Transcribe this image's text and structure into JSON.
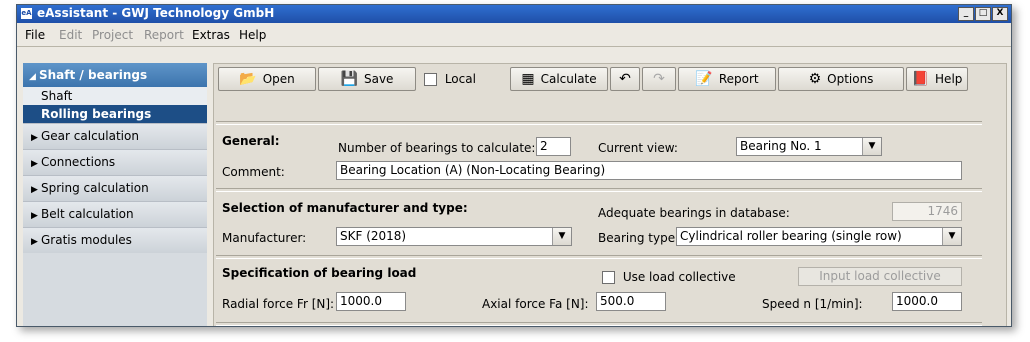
{
  "window": {
    "title": "eAssistant - GWJ Technology GmbH",
    "app_icon": "eA",
    "buttons": {
      "minimize": "_",
      "maximize": "□",
      "close": "X"
    }
  },
  "menubar": {
    "items": [
      {
        "label": "File",
        "enabled": true
      },
      {
        "label": "Edit",
        "enabled": false
      },
      {
        "label": "Project",
        "enabled": false
      },
      {
        "label": "Report",
        "enabled": false
      },
      {
        "label": "Extras",
        "enabled": true
      },
      {
        "label": "Help",
        "enabled": true
      }
    ]
  },
  "sidebar": {
    "header": "Shaft / bearings",
    "sub_items": [
      "Shaft",
      "Rolling bearings"
    ],
    "groups": [
      "Gear calculation",
      "Connections",
      "Spring calculation",
      "Belt calculation",
      "Gratis modules"
    ]
  },
  "toolbar": {
    "open": "Open",
    "save": "Save",
    "local": "Local",
    "calculate": "Calculate",
    "report": "Report",
    "options": "Options",
    "help": "Help",
    "undo_icon": "undo-icon",
    "redo_icon": "redo-icon"
  },
  "general": {
    "heading": "General:",
    "num_bearings_label": "Number of bearings to calculate:",
    "num_bearings_value": "2",
    "current_view_label": "Current view:",
    "current_view_value": "Bearing No. 1",
    "comment_label": "Comment:",
    "comment_value": "Bearing Location (A) (Non-Locating Bearing)"
  },
  "selection": {
    "heading": "Selection of manufacturer and type:",
    "adequate_label": "Adequate bearings in database:",
    "adequate_value": "1746",
    "manufacturer_label": "Manufacturer:",
    "manufacturer_value": "SKF (2018)",
    "bearing_type_label": "Bearing type:",
    "bearing_type_value": "Cylindrical roller bearing (single row)"
  },
  "load": {
    "heading": "Specification of bearing load",
    "use_collective_label": "Use load collective",
    "input_collective_label": "Input load collective",
    "radial_label": "Radial force Fr [N]:",
    "radial_value": "1000.0",
    "axial_label": "Axial force Fa [N]:",
    "axial_value": "500.0",
    "speed_label": "Speed n [1/min]:",
    "speed_value": "1000.0"
  }
}
